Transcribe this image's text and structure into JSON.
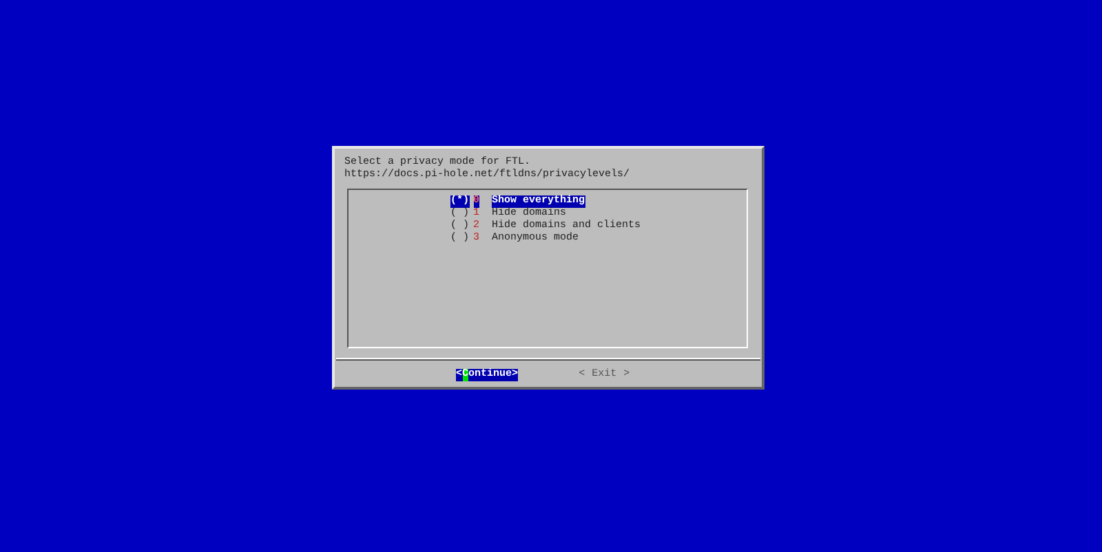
{
  "prompt": [
    "Select a privacy mode for FTL.",
    "https://docs.pi-hole.net/ftldns/privacylevels/"
  ],
  "options": [
    {
      "radio": "(*)",
      "tag": "0",
      "label": "Show everything",
      "selected": true
    },
    {
      "radio": "( )",
      "tag": "1",
      "label": "Hide domains",
      "selected": false
    },
    {
      "radio": "( )",
      "tag": "2",
      "label": "Hide domains and clients",
      "selected": false
    },
    {
      "radio": "( )",
      "tag": "3",
      "label": "Anonymous mode",
      "selected": false
    }
  ],
  "buttons": [
    {
      "left": "<",
      "hotkey": "C",
      "rest": "ontinue",
      "right": ">",
      "selected": true
    },
    {
      "left": "<",
      "hotkey": "E",
      "rest": "xit",
      "right": ">",
      "selected": false
    }
  ]
}
